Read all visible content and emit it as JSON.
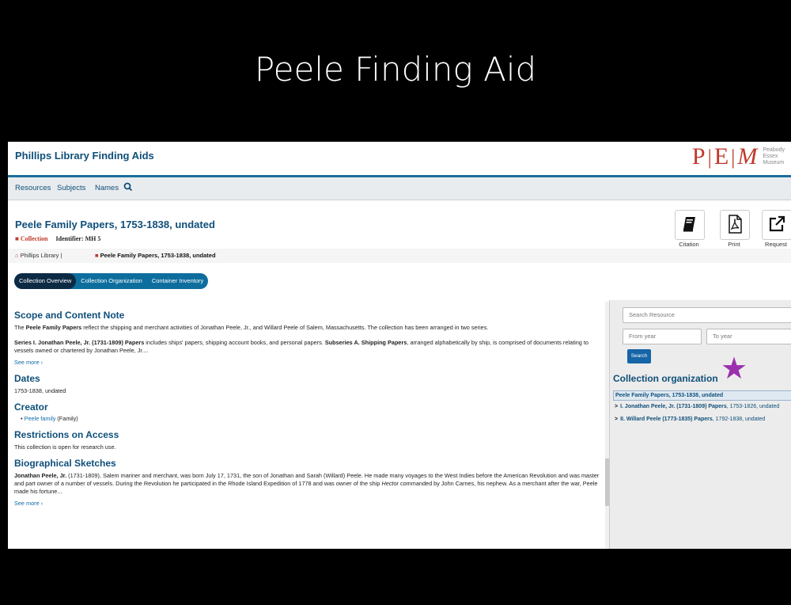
{
  "slide": {
    "title": "Peele Finding Aid"
  },
  "header": {
    "site_title": "Phillips Library Finding Aids",
    "logo": {
      "letters": [
        "P",
        "E",
        "M"
      ],
      "words": [
        "Peabody",
        "Essex",
        "Museum"
      ]
    }
  },
  "nav": {
    "items": [
      "Resources",
      "Subjects",
      "Names"
    ],
    "search_icon": "search-icon"
  },
  "record": {
    "title": "Peele Family Papers, 1753-1838, undated",
    "type_label": "Collection",
    "identifier": "Identifier: MH 5"
  },
  "toolbar": {
    "citation": "Citation",
    "print": "Print",
    "request": "Request"
  },
  "breadcrumb": {
    "repo": "Phillips Library",
    "separator": "|",
    "current": "Peele Family Papers, 1753-1838, undated"
  },
  "tabs": [
    "Collection Overview",
    "Collection Organization",
    "Container Inventory"
  ],
  "content": {
    "scope": {
      "heading": "Scope and Content Note",
      "p1_pre": "The ",
      "p1_bold": "Peele Family Papers",
      "p1_post": " reflect the shipping and merchant activities of Jonathan Peele, Jr., and Willard Peele of Salem, Massachusetts. The collection has been arranged in two series.",
      "p2_bold1": "Series I. Jonathan Peele, Jr. (1731-1809) Papers",
      "p2_mid": " includes ships' papers, shipping account books, and personal papers. ",
      "p2_bold2": "Subseries A. Shipping Papers",
      "p2_post": ", arranged alphabetically by ship, is comprised of documents relating to vessels owned or chartered by Jonathan Peele, Jr....",
      "see_more": "See more ›"
    },
    "dates": {
      "heading": "Dates",
      "value": "1753-1838, undated"
    },
    "creator": {
      "heading": "Creator",
      "name": "Peele family",
      "role": " (Family)"
    },
    "restrictions": {
      "heading": "Restrictions on Access",
      "text": "This collection is open for research use."
    },
    "bio": {
      "heading": "Biographical Sketches",
      "bold": "Jonathan Peele, Jr.",
      "text1": " (1731-1809), Salem mariner and merchant, was born July 17, 1731, the son of Jonathan and Sarah (Willard) Peele. He made many voyages to the West Indies before the American Revolution and was master and part owner of a number of vessels. During the Revolution he participated in the Rhode Island Expedition of 1778 and was owner of the ship ",
      "ship": "Hector",
      "text2": " commanded by John Carnes, his nephew. As a merchant after the war, Peele made his fortune...",
      "see_more": "See more ›"
    }
  },
  "sidebar": {
    "search_placeholder": "Search Resource",
    "from_placeholder": "From year",
    "to_placeholder": "To year",
    "search_button": "Search",
    "org_heading": "Collection organization",
    "tree_root": "Peele Family Papers, 1753-1838, undated",
    "tree_items": [
      {
        "bold": "I. Jonathan Peele, Jr. (1731-1809) Papers",
        "rest": ", 1753-1826, undated"
      },
      {
        "bold": "II. Willard Peele (1773-1835) Papers",
        "rest": ", 1792-1838, undated"
      }
    ]
  },
  "colors": {
    "accent": "#0f4f7a",
    "tab_bar": "#0d6e9e",
    "tab_active": "#0d2a44",
    "pem_red": "#c0392b",
    "star": "#9c2fae"
  }
}
